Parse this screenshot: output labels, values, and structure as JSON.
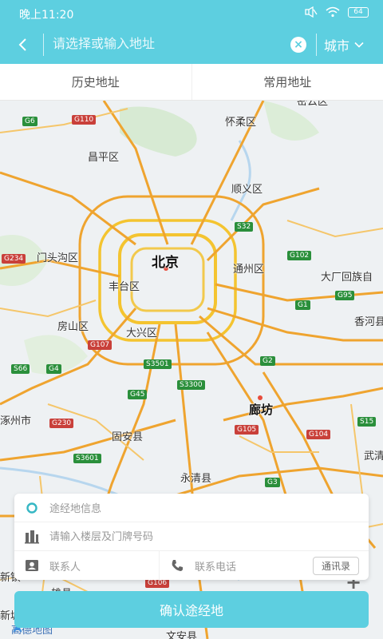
{
  "status": {
    "time": "晚上11:20",
    "battery": "64"
  },
  "search": {
    "placeholder": "请选择或输入地址",
    "city_label": "城市"
  },
  "tabs": [
    {
      "label": "历史地址"
    },
    {
      "label": "常用地址"
    }
  ],
  "map": {
    "places": [
      {
        "name": "北京",
        "major": true
      },
      {
        "name": "廊坊",
        "major": true
      },
      {
        "name": "怀柔区"
      },
      {
        "name": "昌平区"
      },
      {
        "name": "顺义区"
      },
      {
        "name": "门头沟区"
      },
      {
        "name": "通州区"
      },
      {
        "name": "丰台区"
      },
      {
        "name": "大厂回族自"
      },
      {
        "name": "房山区"
      },
      {
        "name": "大兴区"
      },
      {
        "name": "香河县"
      },
      {
        "name": "涿州市"
      },
      {
        "name": "固安县"
      },
      {
        "name": "永清县"
      },
      {
        "name": "武清"
      },
      {
        "name": "雄县"
      },
      {
        "name": "文安县"
      },
      {
        "name": "新镇"
      },
      {
        "name": "新城"
      },
      {
        "name": "密云区"
      }
    ],
    "roads": [
      {
        "code": "G6",
        "color": "green"
      },
      {
        "code": "G110",
        "color": "red"
      },
      {
        "code": "G234",
        "color": "red"
      },
      {
        "code": "S32",
        "color": "green"
      },
      {
        "code": "G102",
        "color": "green"
      },
      {
        "code": "G1",
        "color": "green"
      },
      {
        "code": "G95",
        "color": "green"
      },
      {
        "code": "G107",
        "color": "red"
      },
      {
        "code": "S66",
        "color": "green"
      },
      {
        "code": "G4",
        "color": "green"
      },
      {
        "code": "G2",
        "color": "green"
      },
      {
        "code": "S3501",
        "color": "green"
      },
      {
        "code": "S3300",
        "color": "green"
      },
      {
        "code": "G45",
        "color": "green"
      },
      {
        "code": "G230",
        "color": "red"
      },
      {
        "code": "G105",
        "color": "red"
      },
      {
        "code": "G104",
        "color": "red"
      },
      {
        "code": "S15",
        "color": "green"
      },
      {
        "code": "S3601",
        "color": "green"
      },
      {
        "code": "G3",
        "color": "green"
      },
      {
        "code": "G106",
        "color": "red"
      }
    ],
    "provider": "高德地图"
  },
  "card": {
    "waypoint_info": "途经地信息",
    "floor_placeholder": "请输入楼层及门牌号码",
    "contact_name": "联系人",
    "contact_phone": "联系电话",
    "contacts_button": "通讯录"
  },
  "confirm_label": "确认途经地",
  "colors": {
    "accent": "#5dcfe0",
    "road_green": "#2a8f3b",
    "road_red": "#c9403a"
  }
}
